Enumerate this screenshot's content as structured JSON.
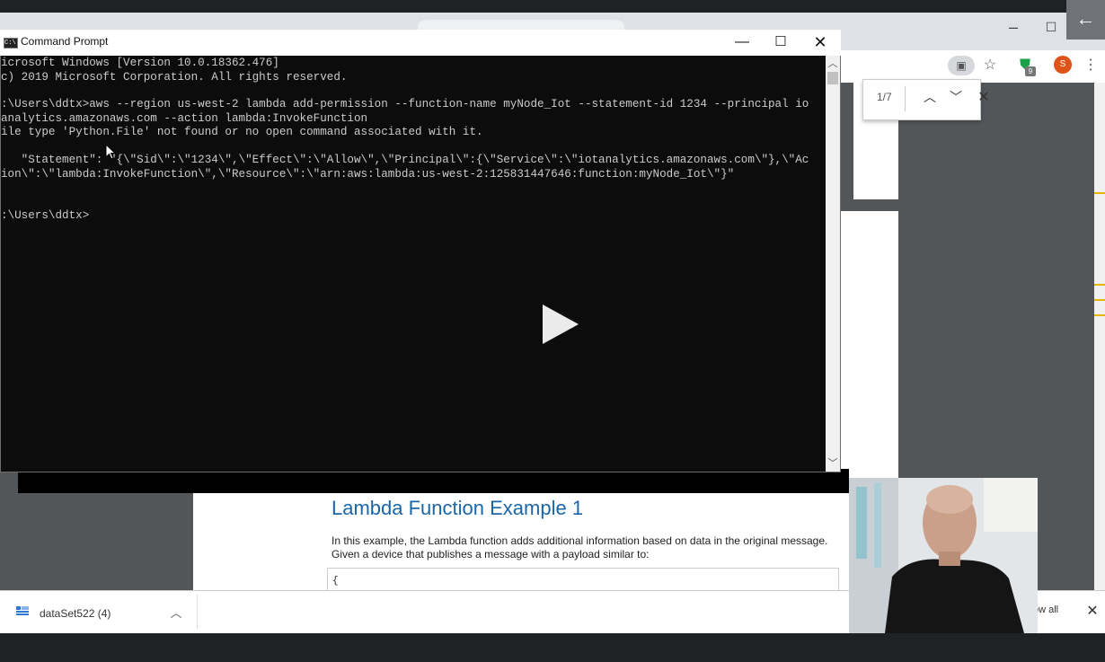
{
  "browser": {
    "back_icon": "arrow-left-icon",
    "ext_pdf_icon": "pdf-extension-icon",
    "star_icon": "star-icon",
    "shield_icon": "shield-check-icon",
    "shield_badge": "9",
    "avatar_letter": "S",
    "menu_icon": "kebab-menu-icon",
    "find": {
      "count": "1/7"
    }
  },
  "cmd": {
    "title": "Command Prompt",
    "lines": [
      "icrosoft Windows [Version 10.0.18362.476]",
      "c) 2019 Microsoft Corporation. All rights reserved.",
      "",
      ":\\Users\\ddtx>aws --region us-west-2 lambda add-permission --function-name myNode_Iot --statement-id 1234 --principal io",
      "analytics.amazonaws.com --action lambda:InvokeFunction",
      "ile type 'Python.File' not found or no open command associated with it.",
      "",
      "   \"Statement\": \"{\\\"Sid\\\":\\\"1234\\\",\\\"Effect\\\":\\\"Allow\\\",\\\"Principal\\\":{\\\"Service\\\":\\\"iotanalytics.amazonaws.com\\\"},\\\"Ac",
      "ion\\\":\\\"lambda:InvokeFunction\\\",\\\"Resource\\\":\\\"arn:aws:lambda:us-west-2:125831447646:function:myNode_Iot\\\"}\"",
      "",
      "",
      "",
      ":\\Users\\ddtx>"
    ]
  },
  "doc": {
    "heading": "Lambda Function Example 1",
    "text1": "In this example, the Lambda function adds additional information based on data in the original message.",
    "text2": "Given a device that publishes a message with a payload similar to:",
    "code": "{"
  },
  "downloads": {
    "item_name": "dataSet522 (4)",
    "show_all": "ow all"
  },
  "colors": {
    "heading_blue": "#1a66a8",
    "console_bg": "#0c0c0c",
    "console_text": "#cccccc"
  }
}
